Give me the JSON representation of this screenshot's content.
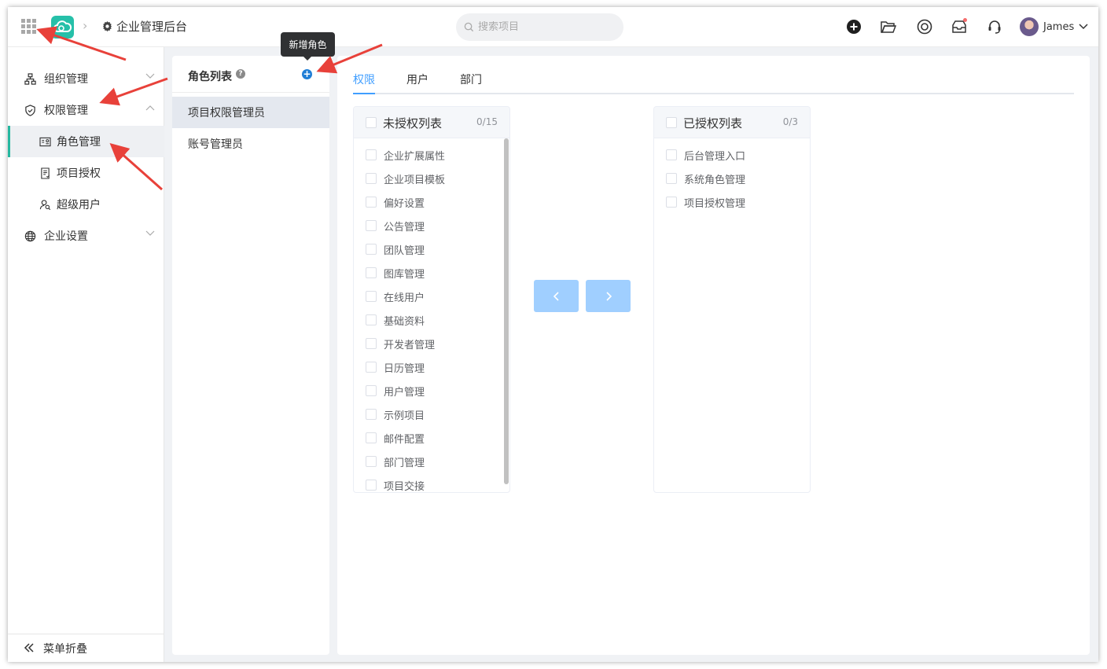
{
  "header": {
    "breadcrumb_title": "企业管理后台",
    "search_placeholder": "搜索项目",
    "user_name": "James"
  },
  "sidebar": {
    "groups": [
      {
        "label": "组织管理",
        "icon": "org-icon",
        "expanded": false
      },
      {
        "label": "权限管理",
        "icon": "shield-icon",
        "expanded": true
      },
      {
        "label": "企业设置",
        "icon": "globe-icon",
        "expanded": false
      }
    ],
    "sub_items": [
      {
        "label": "角色管理",
        "icon": "id-card-icon",
        "active": true
      },
      {
        "label": "项目授权",
        "icon": "document-icon",
        "active": false
      },
      {
        "label": "超级用户",
        "icon": "user-search-icon",
        "active": false
      }
    ],
    "collapse_label": "菜单折叠"
  },
  "role_panel": {
    "title": "角色列表",
    "add_tooltip": "新增角色",
    "roles": [
      {
        "label": "项目权限管理员",
        "active": true
      },
      {
        "label": "账号管理员",
        "active": false
      }
    ]
  },
  "tabs": [
    {
      "label": "权限",
      "active": true
    },
    {
      "label": "用户",
      "active": false
    },
    {
      "label": "部门",
      "active": false
    }
  ],
  "transfer": {
    "left": {
      "title": "未授权列表",
      "count": "0/15",
      "items": [
        "企业扩展属性",
        "企业项目模板",
        "偏好设置",
        "公告管理",
        "团队管理",
        "图库管理",
        "在线用户",
        "基础资料",
        "开发者管理",
        "日历管理",
        "用户管理",
        "示例项目",
        "邮件配置",
        "部门管理",
        "项目交接"
      ]
    },
    "right": {
      "title": "已授权列表",
      "count": "0/3",
      "items": [
        "后台管理入口",
        "系统角色管理",
        "项目授权管理"
      ]
    }
  },
  "colors": {
    "accent": "#409eff",
    "brand": "#26c0a9",
    "annotation": "#e8413a"
  }
}
